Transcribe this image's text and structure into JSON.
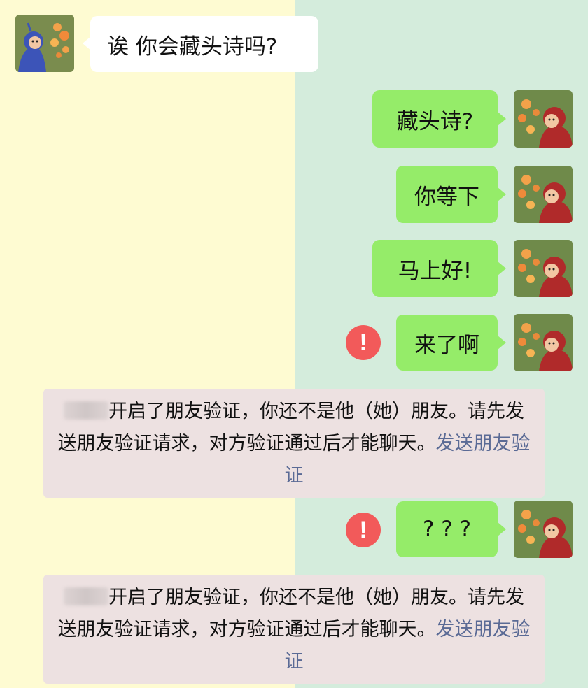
{
  "messages": [
    {
      "side": "in",
      "text": "诶 你会藏头诗吗?"
    },
    {
      "side": "out",
      "text": "藏头诗?"
    },
    {
      "side": "out",
      "text": "你等下"
    },
    {
      "side": "out",
      "text": "马上好!"
    },
    {
      "side": "out",
      "text": "来了啊",
      "failed": true
    },
    {
      "side": "out",
      "text": "? ? ?",
      "failed": true
    }
  ],
  "error_icon": {
    "glyph": "!",
    "color": "#f25a5a"
  },
  "notice": {
    "text": "开启了朋友验证，你还不是他（她）朋友。请先发送朋友验证请求，对方验证通过后才能聊天。",
    "link": "发送朋友验证"
  },
  "colors": {
    "left_bg": "#fefbd2",
    "right_bg": "#d4ecdc",
    "sent_bubble": "#95ec69",
    "received_bubble": "#ffffff",
    "notice_bg": "#ede1e1",
    "link": "#5a6a95"
  }
}
